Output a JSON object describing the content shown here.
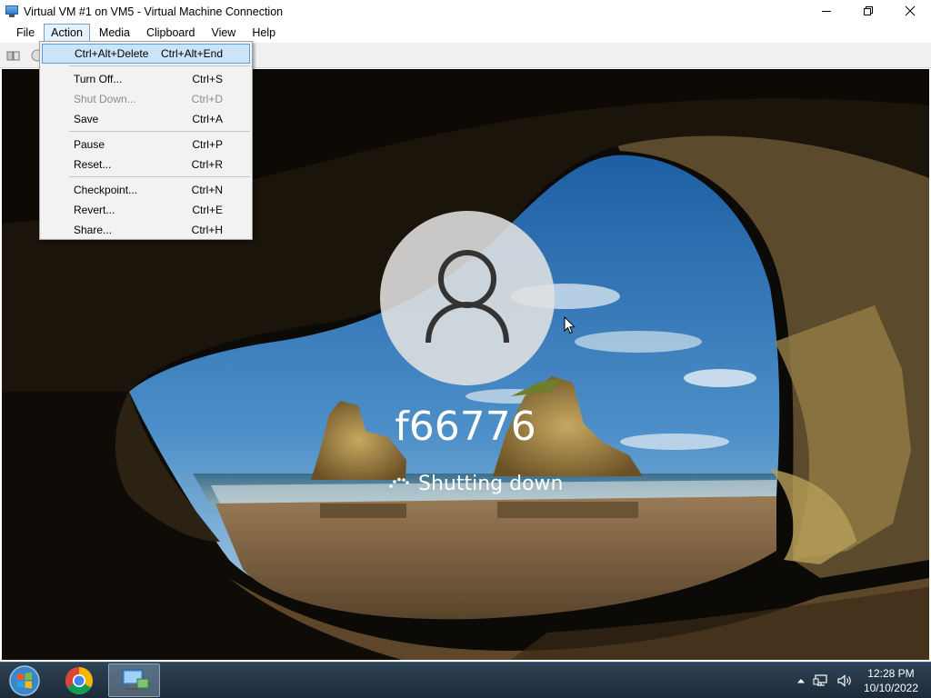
{
  "window": {
    "title": "Virtual VM #1 on VM5 - Virtual Machine Connection",
    "controls": [
      "minimize",
      "restore",
      "close"
    ]
  },
  "menubar": {
    "items": [
      {
        "label": "File"
      },
      {
        "label": "Action",
        "open": true
      },
      {
        "label": "Media"
      },
      {
        "label": "Clipboard"
      },
      {
        "label": "View"
      },
      {
        "label": "Help"
      }
    ]
  },
  "action_menu": {
    "items": [
      {
        "label": "Ctrl+Alt+Delete",
        "shortcut": "Ctrl+Alt+End",
        "highlighted": true
      },
      {
        "label": "Turn Off...",
        "shortcut": "Ctrl+S"
      },
      {
        "label": "Shut Down...",
        "shortcut": "Ctrl+D",
        "disabled": true
      },
      {
        "label": "Save",
        "shortcut": "Ctrl+A"
      },
      {
        "label": "Pause",
        "shortcut": "Ctrl+P"
      },
      {
        "label": "Reset...",
        "shortcut": "Ctrl+R"
      },
      {
        "label": "Checkpoint...",
        "shortcut": "Ctrl+N"
      },
      {
        "label": "Revert...",
        "shortcut": "Ctrl+E"
      },
      {
        "label": "Share...",
        "shortcut": "Ctrl+H"
      }
    ]
  },
  "guest": {
    "username": "f66776",
    "status": "Shutting down",
    "avatar_icon": "user-icon",
    "background": "sea-cave-wallpaper"
  },
  "taskbar": {
    "apps": [
      "windows-start-icon",
      "chrome-icon",
      "virtual-machine-connection-icon"
    ],
    "tray_icons": [
      "show-hidden-icons-icon",
      "network-icon",
      "volume-icon"
    ],
    "clock": {
      "time": "12:28 PM",
      "date": "10/10/2022"
    }
  },
  "colors": {
    "menu_highlight": "#cce4f7",
    "taskbar": "#1d2b38",
    "disabled_text": "#8c8c8c"
  }
}
